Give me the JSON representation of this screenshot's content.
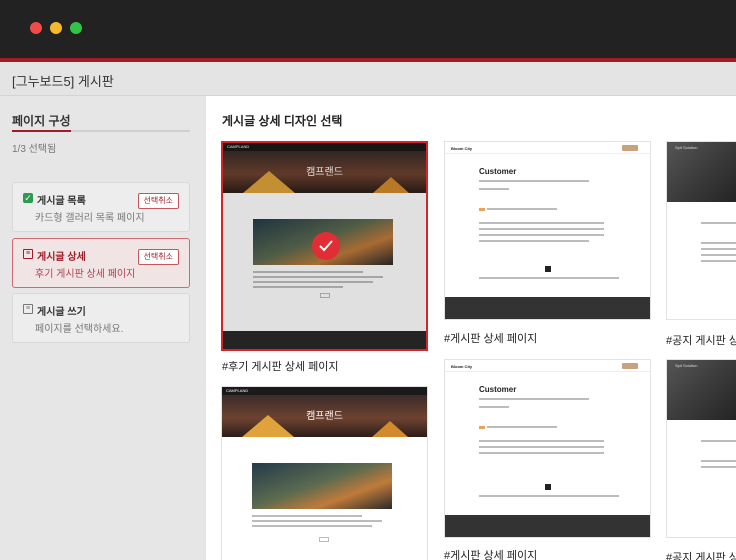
{
  "window": {
    "app_title": "[그누보드5] 게시판"
  },
  "sidebar": {
    "heading": "페이지 구성",
    "progress_fraction": 0.333,
    "count": "1/3 선택됨",
    "steps": [
      {
        "title": "게시글 목록",
        "subtitle": "카드형 갤러리 목록 페이지",
        "action": "선택취소",
        "icon": "check-icon",
        "status": "done"
      },
      {
        "title": "게시글 상세",
        "subtitle": "후기 게시판 상세 페이지",
        "action": "선택취소",
        "icon": "document-icon",
        "status": "active"
      },
      {
        "title": "게시글 쓰기",
        "subtitle": "페이지를 선택하세요.",
        "icon": "document-icon",
        "status": "pending"
      }
    ]
  },
  "panel": {
    "title": "게시글 상세 디자인 선택",
    "cards": [
      {
        "label": "#후기 게시판 상세 페이지",
        "selected": true,
        "preview": {
          "logo": "CAMPLAND",
          "hero_title": "캠프랜드"
        }
      },
      {
        "label": "#게시판 상세 페이지",
        "selected": false,
        "preview": {
          "logo": "Bloom City",
          "heading": "Customer"
        }
      },
      {
        "label": "#공지 게시판 상세 페이지",
        "selected": false,
        "preview": {
          "logo": "Spit Solution"
        }
      },
      {
        "label": "",
        "selected": false,
        "preview": {
          "logo": "CAMPLAND",
          "hero_title": "캠프랜드"
        }
      },
      {
        "label": "#게시판 상세 페이지",
        "selected": false,
        "preview": {
          "logo": "Bloom City",
          "heading": "Customer"
        }
      },
      {
        "label": "#공지 게시판 상세 페이지",
        "selected": false,
        "preview": {
          "logo": "Spit Solution"
        }
      }
    ]
  },
  "colors": {
    "accent": "#a01c26",
    "selected_border": "#d6242d",
    "check_green": "#2d9b4f"
  }
}
